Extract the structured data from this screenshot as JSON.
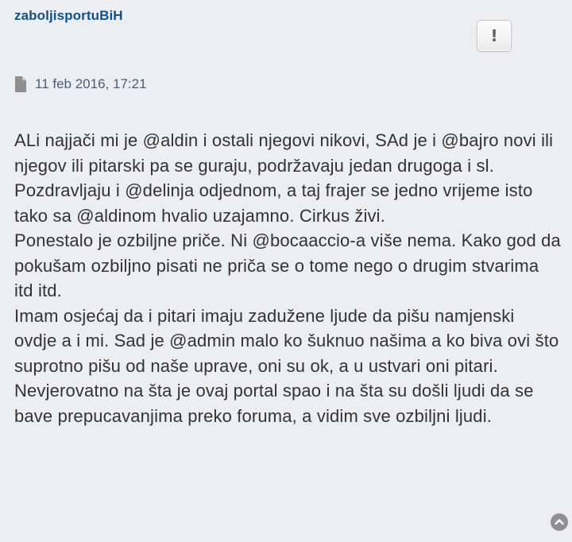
{
  "post": {
    "author": "zaboljisportuBiH",
    "report_icon": "!",
    "date": "11 feb 2016, 17:21",
    "paragraphs": [
      "ALi najjači mi je @aldin i ostali njegovi nikovi, SAd je i @bajro novi ili njegov ili pitarski pa se guraju, podržavaju jedan drugoga i sl. Pozdravljaju i @delinja odjednom, a taj frajer se jedno vrijeme isto tako sa @aldinom hvalio uzajamno. Cirkus živi.",
      "Ponestalo je ozbiljne priče. Ni @bocaaccio-a više nema. Kako god da pokušam ozbiljno pisati ne priča se o tome nego o drugim stvarima itd itd.",
      "Imam osjećaj da i pitari imaju zadužene ljude da pišu namjenski ovdje a i mi. Sad je @admin malo ko šuknuo našima a ko biva ovi što suprotno pišu od naše uprave, oni su ok, a u ustvari oni pitari.",
      "Nevjerovatno na šta je ovaj portal spao i na šta su došli ljudi da se bave prepucavanjima preko foruma, a vidim sve ozbiljni ljudi."
    ]
  },
  "icons": {
    "post": "file-icon",
    "report": "report-icon",
    "top": "chevron-up-icon"
  },
  "colors": {
    "background": "#eceef1",
    "author": "#105289",
    "text": "#333333",
    "meta": "#4c5d77"
  }
}
